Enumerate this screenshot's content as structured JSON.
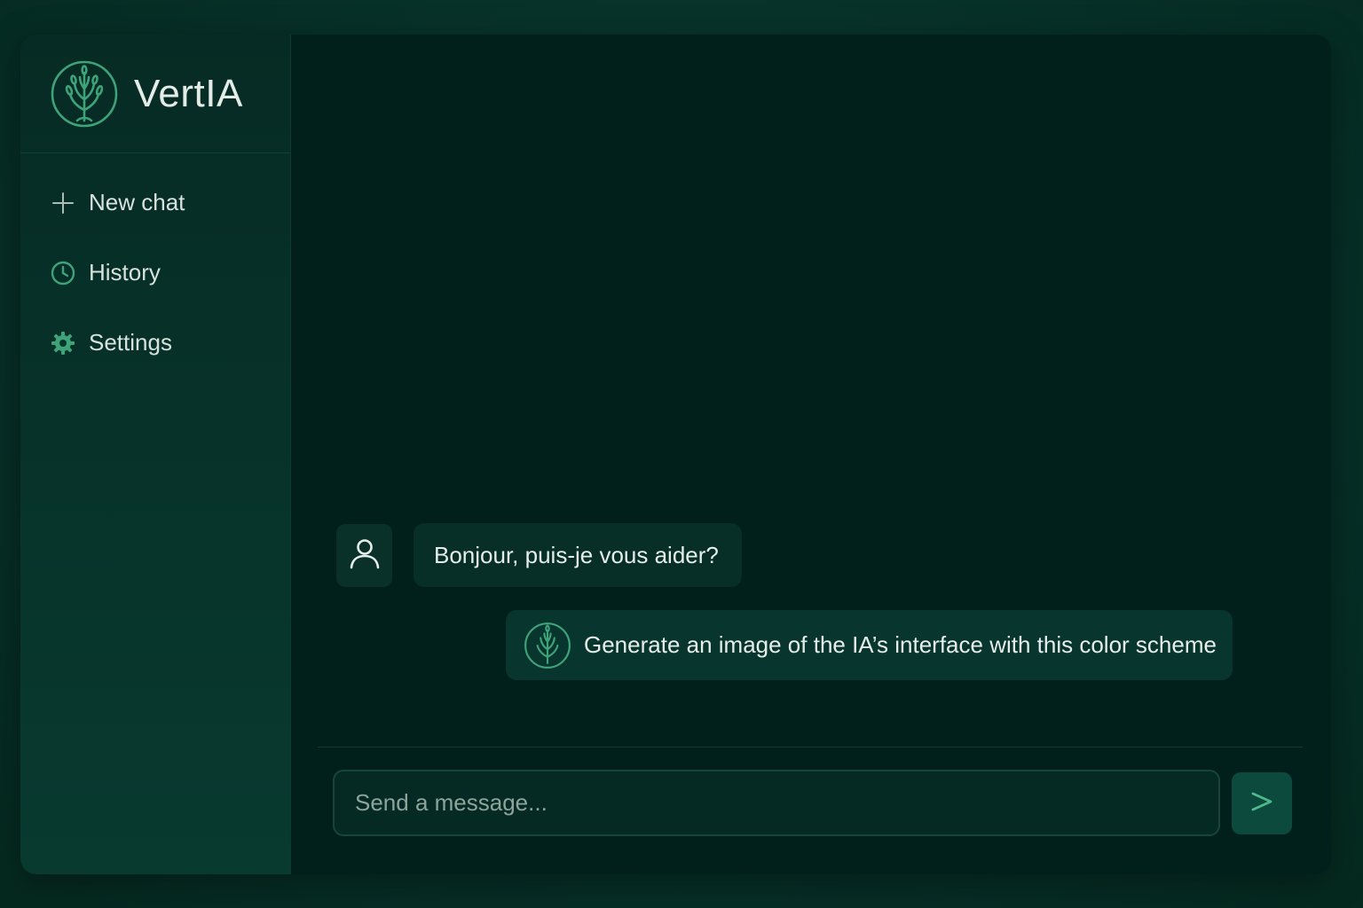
{
  "app": {
    "name": "VertIA"
  },
  "sidebar": {
    "items": [
      {
        "label": "New chat",
        "icon": "plus-icon"
      },
      {
        "label": "History",
        "icon": "clock-icon"
      },
      {
        "label": "Settings",
        "icon": "gear-icon"
      }
    ]
  },
  "chat": {
    "messages": [
      {
        "role": "user",
        "avatar": "user-icon",
        "text": "Bonjour, puis-je vous aider?"
      },
      {
        "role": "assistant",
        "avatar": "tree-logo-icon",
        "text": "Generate an image of the IA’s interface with this color scheme"
      }
    ]
  },
  "composer": {
    "placeholder": "Send a message...",
    "value": "",
    "send_icon": "send-chevron-icon"
  },
  "colors": {
    "accent": "#3fa37a",
    "background": "#02201b",
    "sidebar": "#07342b",
    "bubble": "#072e27",
    "send_button": "#0b4a3c"
  }
}
